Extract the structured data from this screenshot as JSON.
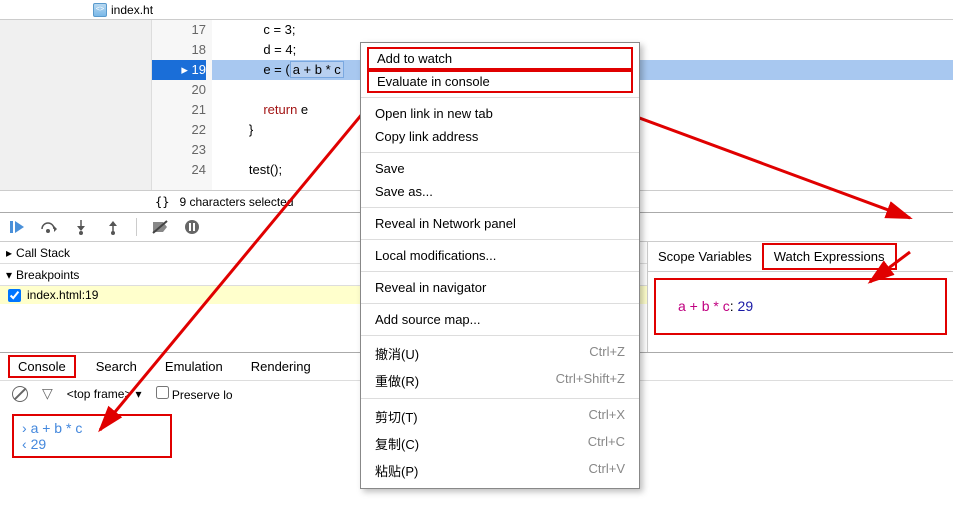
{
  "tab": {
    "filename": "index.ht"
  },
  "gutter_lines": [
    "17",
    "18",
    "19",
    "20",
    "21",
    "22",
    "23",
    "24"
  ],
  "current_line": "19",
  "code_lines": [
    {
      "pre": "            c = 3;",
      "type": "plain"
    },
    {
      "pre": "            d = 4;",
      "type": "plain"
    },
    {
      "pre": "            e = (",
      "hl": "a + b * c",
      "type": "highlight"
    },
    {
      "pre": "",
      "type": "plain"
    },
    {
      "pre": "            ",
      "kw": "return",
      "post": " e",
      "type": "kw"
    },
    {
      "pre": "        }",
      "type": "plain"
    },
    {
      "pre": "",
      "type": "plain"
    },
    {
      "pre": "        test();",
      "type": "plain"
    }
  ],
  "status": {
    "braces": "{}",
    "selection": "9 characters selected"
  },
  "left_panels": {
    "callstack": "Call Stack",
    "breakpoints": "Breakpoints",
    "bp_item": "index.html:19"
  },
  "right_panels": {
    "scope": "Scope Variables",
    "watch": "Watch Expressions",
    "watch_expr": "a + b * c",
    "watch_sep": ": ",
    "watch_val": "29"
  },
  "bottom_tabs": [
    "Console",
    "Search",
    "Emulation",
    "Rendering"
  ],
  "console": {
    "frame": "<top frame>",
    "preserve": "Preserve lo",
    "expr": "a + b * c",
    "result": "29"
  },
  "context_menu": [
    {
      "label": "Add to watch",
      "boxed": true
    },
    {
      "label": "Evaluate in console",
      "boxed": true
    },
    {
      "sep": true
    },
    {
      "label": "Open link in new tab"
    },
    {
      "label": "Copy link address"
    },
    {
      "sep": true
    },
    {
      "label": "Save"
    },
    {
      "label": "Save as..."
    },
    {
      "sep": true
    },
    {
      "label": "Reveal in Network panel"
    },
    {
      "sep": true
    },
    {
      "label": "Local modifications..."
    },
    {
      "sep": true
    },
    {
      "label": "Reveal in navigator"
    },
    {
      "sep": true
    },
    {
      "label": "Add source map..."
    },
    {
      "sep": true
    },
    {
      "label": "撤消(U)",
      "shortcut": "Ctrl+Z"
    },
    {
      "label": "重做(R)",
      "shortcut": "Ctrl+Shift+Z"
    },
    {
      "sep": true
    },
    {
      "label": "剪切(T)",
      "shortcut": "Ctrl+X"
    },
    {
      "label": "复制(C)",
      "shortcut": "Ctrl+C"
    },
    {
      "label": "粘贴(P)",
      "shortcut": "Ctrl+V"
    }
  ]
}
